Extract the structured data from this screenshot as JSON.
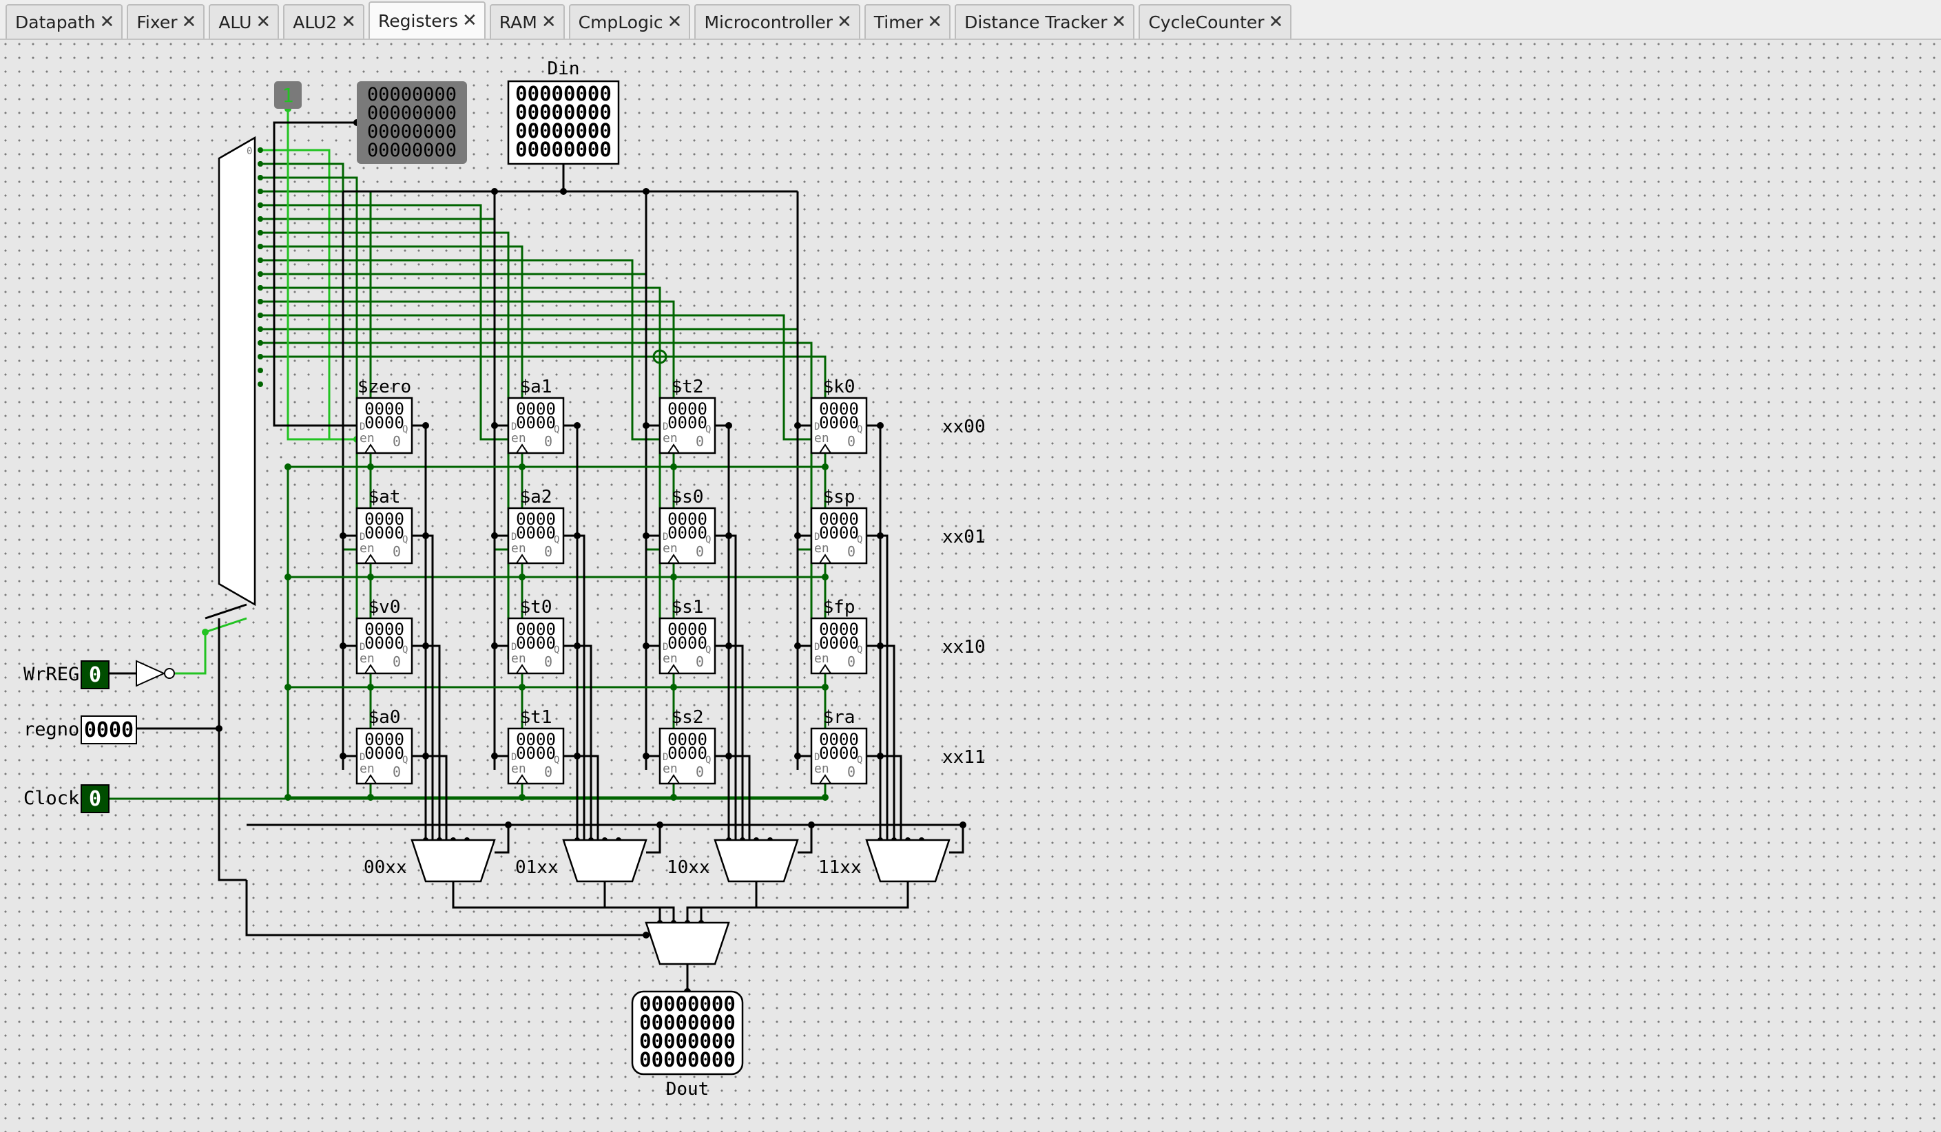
{
  "tabs": [
    {
      "label": "Datapath",
      "active": false
    },
    {
      "label": "Fixer",
      "active": false
    },
    {
      "label": "ALU",
      "active": false
    },
    {
      "label": "ALU2",
      "active": false
    },
    {
      "label": "Registers",
      "active": true
    },
    {
      "label": "RAM",
      "active": false
    },
    {
      "label": "CmpLogic",
      "active": false
    },
    {
      "label": "Microcontroller",
      "active": false
    },
    {
      "label": "Timer",
      "active": false
    },
    {
      "label": "Distance Tracker",
      "active": false
    },
    {
      "label": "CycleCounter",
      "active": false
    }
  ],
  "close_glyph": "✕",
  "inputs": {
    "wrreg": {
      "label": "WrREG",
      "value": "0"
    },
    "regno": {
      "label": "regno",
      "value": "0000"
    },
    "clock": {
      "label": "Clock",
      "value": "0"
    },
    "const_one": "1"
  },
  "zero_constant": [
    "00000000",
    "00000000",
    "00000000",
    "00000000"
  ],
  "din": {
    "label": "Din",
    "rows": [
      "00000000",
      "00000000",
      "00000000",
      "00000000"
    ]
  },
  "dout": {
    "label": "Dout",
    "rows": [
      "00000000",
      "00000000",
      "00000000",
      "00000000"
    ]
  },
  "registers": [
    [
      "$zero",
      "$a1",
      "$t2",
      "$k0"
    ],
    [
      "$at",
      "$a2",
      "$s0",
      "$sp"
    ],
    [
      "$v0",
      "$t0",
      "$s1",
      "$fp"
    ],
    [
      "$a0",
      "$t1",
      "$s2",
      "$ra"
    ]
  ],
  "register_value_rows": [
    "0000",
    "0000"
  ],
  "register_pins": {
    "d": "D",
    "en": "en",
    "q": "Q",
    "zero": "0"
  },
  "row_labels": [
    "xx00",
    "xx01",
    "xx10",
    "xx11"
  ],
  "mux_labels": [
    "00xx",
    "01xx",
    "10xx",
    "11xx"
  ],
  "decoder_zero": "0",
  "colors": {
    "wire_dark_green": "#006400",
    "wire_bright_green": "#22c322",
    "wire_black": "#000000",
    "active_pin": "#0000ff",
    "input_pin_bg": "#004d00",
    "const_one_bg": "#7a7a7a",
    "grid_dot": "#7a7a7a"
  }
}
